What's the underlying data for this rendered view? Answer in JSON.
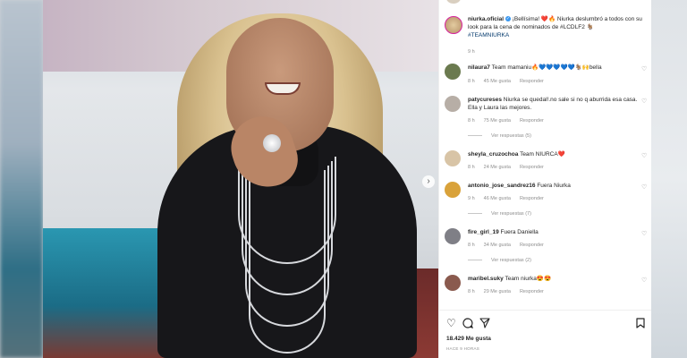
{
  "post": {
    "author": "niurka.oficial",
    "caption_text": "¡Bellísima! ❤️🔥 Niurka deslumbró a todos con su look para la cena de nominados de #LCDLF2 🐐",
    "caption_hashtag": "#TEAMNIURKA",
    "caption_time": "9 h",
    "likes": "18.429 Me gusta",
    "posted_ago": "HACE 9 HORAS"
  },
  "comments": [
    {
      "user": "nilaura7",
      "text": "Team mamaniu🔥💙💙💙💙💙🐐🙌bella",
      "age": "8 h",
      "likes": "45 Me gusta",
      "reply": "Responder",
      "replies": ""
    },
    {
      "user": "patycureses",
      "text": "Niurka se quedal!.no sale si no q aburrida esa casa. Ella y Laura las mejores.",
      "age": "8 h",
      "likes": "75 Me gusta",
      "reply": "Responder",
      "replies": "Ver respuestas (5)"
    },
    {
      "user": "sheyla_cruzochoa",
      "text": "Team NIURCA❤️",
      "age": "8 h",
      "likes": "24 Me gusta",
      "reply": "Responder",
      "replies": ""
    },
    {
      "user": "antonio_jose_sandrez16",
      "text": "Fuera Niurka",
      "age": "9 h",
      "likes": "46 Me gusta",
      "reply": "Responder",
      "replies": "Ver respuestas (7)"
    },
    {
      "user": "fire_girl_19",
      "text": "Fuera Daniella",
      "age": "8 h",
      "likes": "34 Me gusta",
      "reply": "Responder",
      "replies": "Ver respuestas (2)"
    },
    {
      "user": "maribel.suky",
      "text": "Team niurka😍😍",
      "age": "8 h",
      "likes": "29 Me gusta",
      "reply": "Responder",
      "replies": ""
    }
  ],
  "icons": {
    "like": "heart-icon",
    "comment": "comment-icon",
    "share": "paper-plane-icon",
    "save": "bookmark-icon",
    "next": "chevron-right-icon"
  },
  "colors": {
    "verified": "#3897f0",
    "hashtag": "#00376b",
    "meta": "#8e8e8e"
  }
}
